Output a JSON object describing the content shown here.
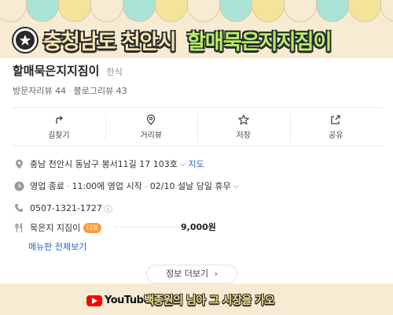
{
  "banner": {
    "title_region": "충청남도 천안시",
    "title_name": "할매묵은지지짐이"
  },
  "place": {
    "name": "할매묵은지지짐이",
    "category": "한식",
    "visitor_reviews": "방문자리뷰 44",
    "blog_reviews": "블로그리뷰 43"
  },
  "actions": [
    {
      "label": "길찾기",
      "icon": "directions-icon"
    },
    {
      "label": "거리뷰",
      "icon": "map-pin-icon"
    },
    {
      "label": "저장",
      "icon": "star-icon"
    },
    {
      "label": "공유",
      "icon": "share-icon"
    }
  ],
  "info": {
    "address": "충남 천안시 동남구 봉서11길 17 103호",
    "map_link": "지도",
    "status": "영업 종료",
    "opening": "11:00에 영업 시작",
    "holiday": "02/10 설날 당일 휴무",
    "phone": "0507-1321-1727",
    "menu_item": "묵은지 지짐이",
    "menu_badge": "대표",
    "menu_price": "9,000원",
    "full_menu_link": "메뉴판 전체보기"
  },
  "more_button": "정보 더보기",
  "footer": {
    "youtube_word": "YouTube",
    "channel": "백종원의 님아 그 시장을 가오"
  },
  "colors": {
    "background": "#f7ecd3",
    "awning_colors": [
      "#f7ecd3",
      "#a8e3d6",
      "#f6e39a"
    ],
    "title_region_fill": "#f7e6b0",
    "title_name_fill": "#b6f06a",
    "link_blue": "#2a5fc9",
    "badge_orange": "#ff9a3c"
  }
}
